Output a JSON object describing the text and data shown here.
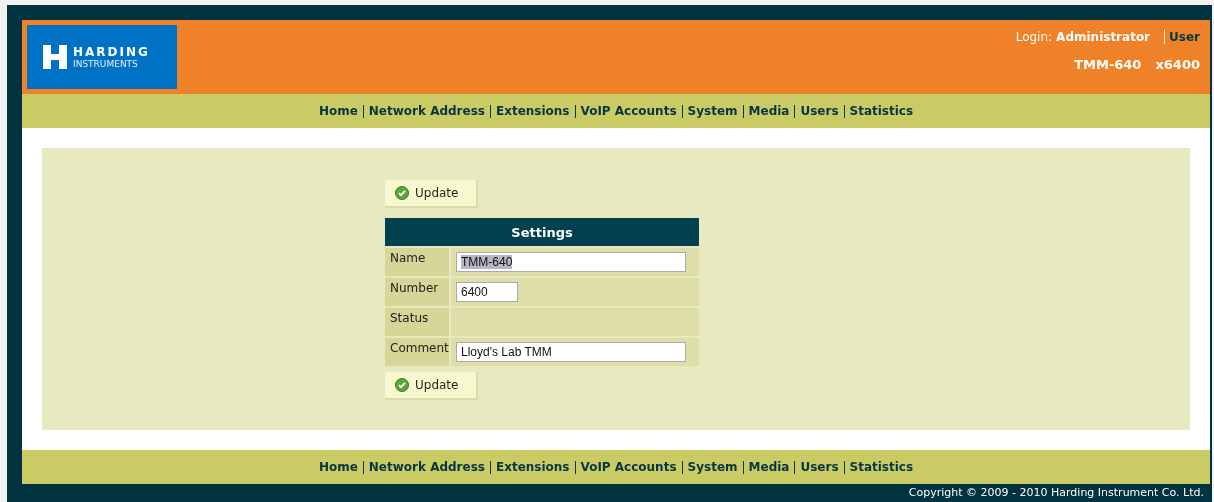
{
  "header": {
    "logo": {
      "line1": "HARDING",
      "line2": "INSTRUMENTS"
    },
    "login_label": "Login:",
    "login_user": "Administrator",
    "role_link": "User",
    "device": "TMM-640",
    "extension": "x6400"
  },
  "top_nav": [
    "Home",
    "Network Address",
    "Extensions",
    "VoIP Accounts",
    "System",
    "Media",
    "Users",
    "Statistics"
  ],
  "update_buttons": [
    "Update",
    "Update"
  ],
  "settings": {
    "title": "Settings",
    "rows": [
      {
        "label": "Name",
        "kind": "wide_input",
        "value": "TMM-640",
        "text_highlighted": true
      },
      {
        "label": "Number",
        "kind": "short_input",
        "value": "6400",
        "text_highlighted": false
      },
      {
        "label": "Status",
        "kind": "text"
      },
      {
        "label": "Comment",
        "kind": "wide_input",
        "value": "Lloyd's Lab TMM",
        "text_highlighted": false
      }
    ]
  },
  "bottom_nav": [
    "Home",
    "Network Address",
    "Extensions",
    "VoIP Accounts",
    "System",
    "Media",
    "Users",
    "Statistics"
  ],
  "copyright": "Copyright © 2009 - 2010 Harding Instrument Co. Ltd."
}
